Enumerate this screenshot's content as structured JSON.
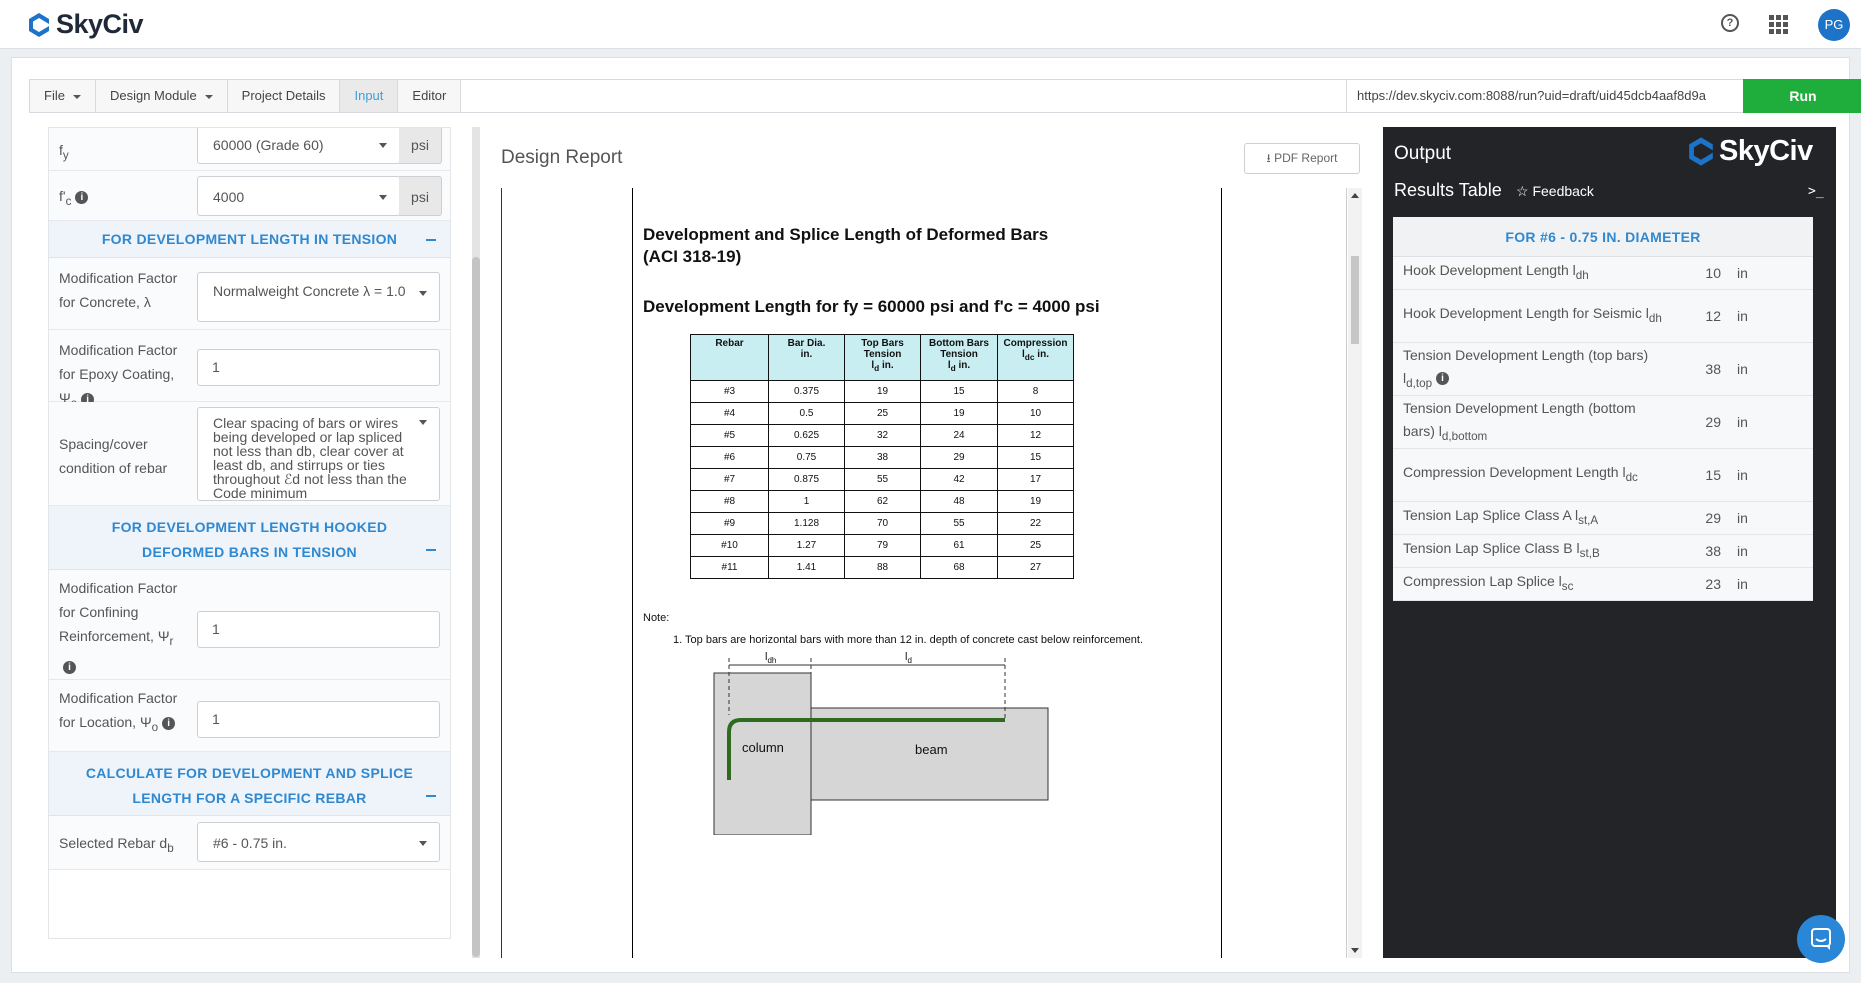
{
  "app": {
    "brand": "SkyCiv",
    "avatar": "PG"
  },
  "toolbar": {
    "file": "File",
    "design_module": "Design Module",
    "project_details": "Project Details",
    "input": "Input",
    "editor": "Editor",
    "url": "https://dev.skyciv.com:8088/run?uid=draft/uid45dcb4aaf8d9a",
    "run": "Run"
  },
  "inputs": {
    "fy_label": "f",
    "fy_sub": "y",
    "fy_value": "60000 (Grade 60)",
    "fy_unit": "psi",
    "fc_label": "f'",
    "fc_sub": "c",
    "fc_value": "4000",
    "fc_unit": "psi",
    "section_tension": "FOR DEVELOPMENT LENGTH IN TENSION",
    "lambda_label": "Modification Factor for Concrete, λ",
    "lambda_value": "Normalweight Concrete λ = 1.0",
    "epoxy_label": "Modification Factor for Epoxy Coating, Ψ",
    "epoxy_sub": "e",
    "epoxy_value": "1",
    "spacing_label": "Spacing/cover condition of rebar",
    "spacing_value": "Clear spacing of bars or wires being developed or lap spliced not less than db, clear cover at least db, and stirrups or ties throughout ℰd not less than the Code minimum",
    "section_hooked": "FOR DEVELOPMENT LENGTH HOOKED DEFORMED BARS IN TENSION",
    "confining_label": "Modification Factor for Confining Reinforcement, Ψ",
    "confining_sub": "r",
    "confining_value": "1",
    "location_label": "Modification Factor for Location, Ψ",
    "location_sub": "o",
    "location_value": "1",
    "section_calc": "CALCULATE FOR DEVELOPMENT AND SPLICE LENGTH FOR A SPECIFIC REBAR",
    "rebar_label": "Selected Rebar d",
    "rebar_sub": "b",
    "rebar_value": "#6 - 0.75 in."
  },
  "report": {
    "title": "Design Report",
    "pdf_button": "PDF Report",
    "doc_title": "Development and Splice Length of Deformed Bars\n(ACI 318-19)",
    "doc_subtitle": "Development Length for fy = 60000 psi and f'c = 4000 psi",
    "table_headers": [
      "Rebar",
      "Bar Dia. in.",
      "Top Bars Tension ld in.",
      "Bottom Bars Tension ld in.",
      "Compression ldc in."
    ],
    "table_rows": [
      [
        "#3",
        "0.375",
        "19",
        "15",
        "8"
      ],
      [
        "#4",
        "0.5",
        "25",
        "19",
        "10"
      ],
      [
        "#5",
        "0.625",
        "32",
        "24",
        "12"
      ],
      [
        "#6",
        "0.75",
        "38",
        "29",
        "15"
      ],
      [
        "#7",
        "0.875",
        "55",
        "42",
        "17"
      ],
      [
        "#8",
        "1",
        "62",
        "48",
        "19"
      ],
      [
        "#9",
        "1.128",
        "70",
        "55",
        "22"
      ],
      [
        "#10",
        "1.27",
        "79",
        "61",
        "25"
      ],
      [
        "#11",
        "1.41",
        "88",
        "68",
        "27"
      ]
    ],
    "note_head": "Note:",
    "note_1": "1. Top bars are horizontal bars with more than 12 in. depth of concrete cast below reinforcement.",
    "diagram": {
      "ldh": "l",
      "ldh_sub": "dh",
      "ld": "l",
      "ld_sub": "d",
      "column": "column",
      "beam": "beam"
    }
  },
  "output": {
    "title": "Output",
    "results_title": "Results Table",
    "feedback": "Feedback",
    "terminal": ">_",
    "section": "FOR #6 - 0.75 IN. DIAMETER",
    "rows": [
      {
        "name": "Hook Development Length l",
        "sub": "dh",
        "value": "10",
        "unit": "in"
      },
      {
        "name": "Hook Development Length for Seismic l",
        "sub": "dh",
        "value": "12",
        "unit": "in"
      },
      {
        "name": "Tension Development Length (top bars) l",
        "sub": "d,top",
        "value": "38",
        "unit": "in"
      },
      {
        "name": "Tension Development Length (bottom bars) l",
        "sub": "d,bottom",
        "value": "29",
        "unit": "in"
      },
      {
        "name": "Compression Development Length l",
        "sub": "dc",
        "value": "15",
        "unit": "in"
      },
      {
        "name": "Tension Lap Splice Class A l",
        "sub": "st,A",
        "value": "29",
        "unit": "in"
      },
      {
        "name": "Tension Lap Splice Class B l",
        "sub": "st,B",
        "value": "38",
        "unit": "in"
      },
      {
        "name": "Compression Lap Splice l",
        "sub": "sc",
        "value": "23",
        "unit": "in"
      }
    ]
  },
  "colors": {
    "accent": "#2f88d0",
    "run": "#1fae3c",
    "output_bg": "#222427",
    "table_header": "#c9eef2",
    "rebar": "#2e6b1f"
  }
}
